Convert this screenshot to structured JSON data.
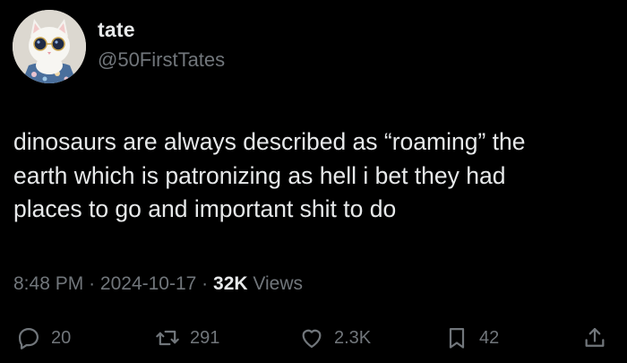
{
  "author": {
    "display_name": "tate",
    "handle": "@50FirstTates",
    "avatar_icon": "cat-with-sunglasses-avatar"
  },
  "tweet": {
    "text": "dinosaurs are always described as “roaming” the\nearth which is patronizing as hell i bet they had\nplaces to go and important shit to do"
  },
  "meta": {
    "time": "8:48 PM",
    "separator": "·",
    "date": "2024-10-17",
    "views_count": "32K",
    "views_label": "Views"
  },
  "actions": {
    "replies": "20",
    "reposts": "291",
    "likes": "2.3K",
    "bookmarks": "42"
  },
  "colors": {
    "background": "#000000",
    "text_primary": "#e7e9ea",
    "text_secondary": "#71767b"
  }
}
